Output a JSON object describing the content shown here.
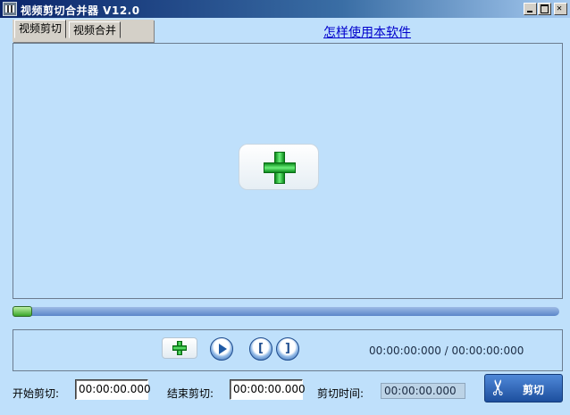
{
  "window": {
    "title": "视频剪切合并器 V12.0"
  },
  "tabs": [
    {
      "label": "视频剪切",
      "active": true
    },
    {
      "label": "视频合并",
      "active": false
    }
  ],
  "help_link": "怎样使用本软件",
  "progress": {
    "fraction": 0.0
  },
  "controls": {
    "start_mark": "[",
    "end_mark": "]",
    "time_display": "00:00:00:000 / 00:00:00:000"
  },
  "fields": {
    "start_label": "开始剪切:",
    "start_value": "00:00:00.000",
    "end_label": "结束剪切:",
    "end_value": "00:00:00.000",
    "duration_label": "剪切时间:",
    "duration_value": "00:00:00.000"
  },
  "cut_button": {
    "label": "剪切"
  },
  "icons": {
    "app": "film-icon",
    "add": "add-plus-icon",
    "play": "play-icon",
    "cut": "scissors-icon"
  }
}
